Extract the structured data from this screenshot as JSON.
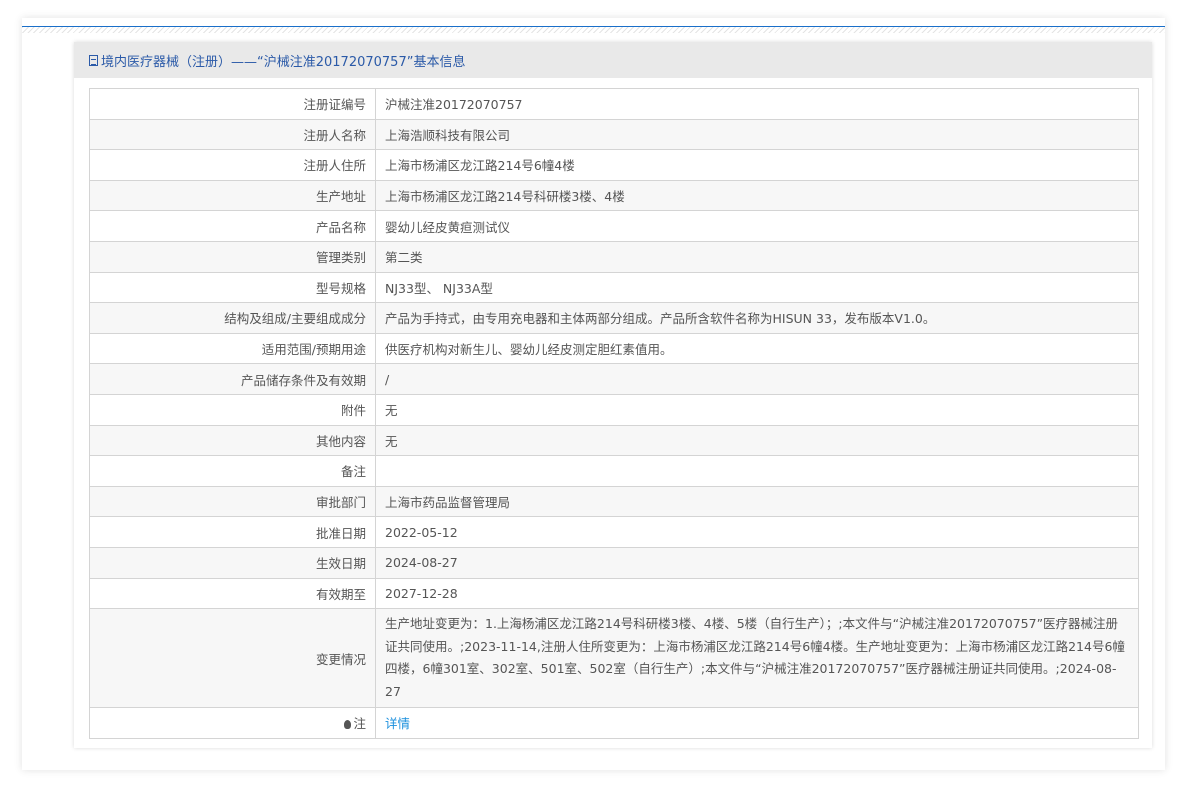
{
  "panel": {
    "title": "境内医疗器械（注册）——“沪械注准20172070757”基本信息"
  },
  "rows": [
    {
      "label": "注册证编号",
      "value": "沪械注准20172070757"
    },
    {
      "label": "注册人名称",
      "value": "上海浩顺科技有限公司"
    },
    {
      "label": "注册人住所",
      "value": "上海市杨浦区龙江路214号6幢4楼"
    },
    {
      "label": "生产地址",
      "value": "上海市杨浦区龙江路214号科研楼3楼、4楼"
    },
    {
      "label": "产品名称",
      "value": "婴幼儿经皮黄疸测试仪"
    },
    {
      "label": "管理类别",
      "value": "第二类"
    },
    {
      "label": "型号规格",
      "value": "NJ33型、 NJ33A型"
    },
    {
      "label": "结构及组成/主要组成成分",
      "value": "产品为手持式，由专用充电器和主体两部分组成。产品所含软件名称为HISUN 33，发布版本V1.0。"
    },
    {
      "label": "适用范围/预期用途",
      "value": "供医疗机构对新生儿、婴幼儿经皮测定胆红素值用。"
    },
    {
      "label": "产品储存条件及有效期",
      "value": "/"
    },
    {
      "label": "附件",
      "value": "无"
    },
    {
      "label": "其他内容",
      "value": "无"
    },
    {
      "label": "备注",
      "value": ""
    },
    {
      "label": "审批部门",
      "value": "上海市药品监督管理局"
    },
    {
      "label": "批准日期",
      "value": "2022-05-12"
    },
    {
      "label": "生效日期",
      "value": "2024-08-27"
    },
    {
      "label": "有效期至",
      "value": "2027-12-28"
    },
    {
      "label": "变更情况",
      "value": "生产地址变更为：1.上海杨浦区龙江路214号科研楼3楼、4楼、5楼（自行生产）；;本文件与“沪械注准20172070757”医疗器械注册证共同使用。;2023-11-14,注册人住所变更为：上海市杨浦区龙江路214号6幢4楼。生产地址变更为：上海市杨浦区龙江路214号6幢四楼，6幢301室、302室、501室、502室（自行生产）;本文件与“沪械注准20172070757”医疗器械注册证共同使用。;2024-08-27"
    }
  ],
  "note": {
    "label": "注",
    "link": "详情"
  }
}
